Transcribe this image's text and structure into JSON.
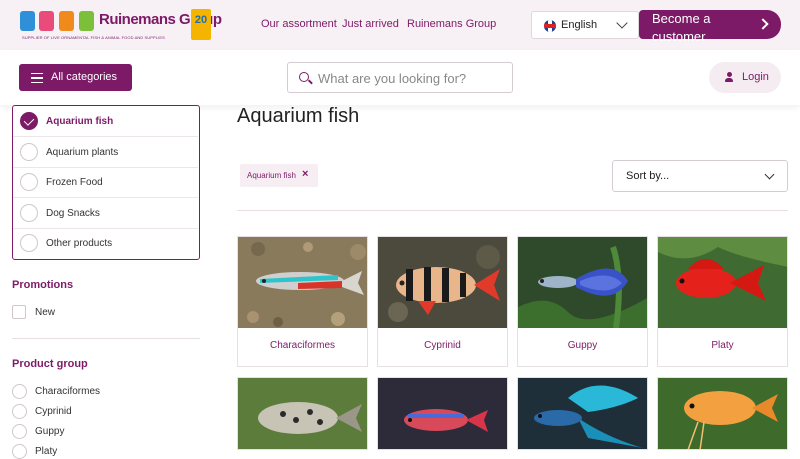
{
  "header": {
    "brand": "Ruinemans Group",
    "tagline": "SUPPLIER OF LIVE ORNAMENTAL FISH & ANIMAL FOOD AND SUPPLIES",
    "badge": "20",
    "nav": [
      "Our assortment",
      "Just arrived",
      "Ruinemans Group"
    ],
    "language": "English",
    "cta": "Become a customer"
  },
  "toolbar": {
    "all_categories": "All categories",
    "search_placeholder": "What are you looking for?",
    "login": "Login"
  },
  "sidebar": {
    "categories": [
      {
        "label": "Aquarium fish",
        "checked": true
      },
      {
        "label": "Aquarium plants",
        "checked": false
      },
      {
        "label": "Frozen Food",
        "checked": false
      },
      {
        "label": "Dog Snacks",
        "checked": false
      },
      {
        "label": "Other products",
        "checked": false
      }
    ],
    "promotions_title": "Promotions",
    "promotions": [
      {
        "label": "New",
        "checked": false
      }
    ],
    "product_group_title": "Product group",
    "product_groups": [
      "Characiformes",
      "Cyprinid",
      "Guppy",
      "Platy"
    ]
  },
  "main": {
    "title": "Aquarium fish",
    "active_filter": "Aquarium fish",
    "filter_remove": "×",
    "sort_label": "Sort by...",
    "products": [
      {
        "name": "Characiformes"
      },
      {
        "name": "Cyprinid"
      },
      {
        "name": "Guppy"
      },
      {
        "name": "Platy"
      },
      {
        "name": ""
      },
      {
        "name": ""
      },
      {
        "name": ""
      },
      {
        "name": ""
      }
    ]
  },
  "colors": {
    "brand": "#7d1a67",
    "topbar_bg": "#f7f0f5"
  }
}
